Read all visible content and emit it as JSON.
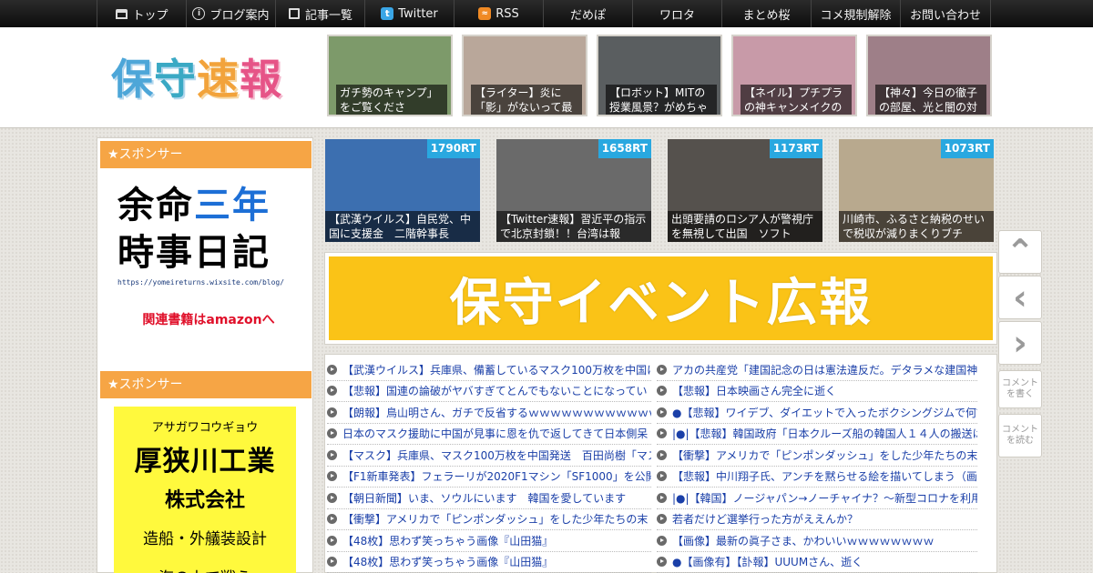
{
  "nav": {
    "items": [
      {
        "label": "トップ",
        "icon": "home-icon"
      },
      {
        "label": "ブログ案内",
        "icon": "info-icon"
      },
      {
        "label": "記事一覧",
        "icon": "list-icon"
      },
      {
        "label": "Twitter",
        "icon": "twitter-icon"
      },
      {
        "label": "RSS",
        "icon": "rss-icon"
      },
      {
        "label": "だめぽ"
      },
      {
        "label": "ワロタ"
      },
      {
        "label": "まとめ桜"
      },
      {
        "label": "コメ規制解除"
      },
      {
        "label": "お問い合わせ"
      }
    ],
    "icon_glyphs": {
      "info": "i",
      "twitter": "t",
      "rss": "≈"
    }
  },
  "header": {
    "logo": {
      "c1": "保",
      "c2": "守",
      "c3": "速",
      "c4": "報"
    },
    "thumbs": [
      {
        "caption": "ガチ勢のキャンプ」をご覧くださ",
        "color": "#7d9a6a"
      },
      {
        "caption": "【ライター】炎に「影」がないって最",
        "color": "#b9a79a"
      },
      {
        "caption": "【ロボット】MITの授業風景？がめちゃ",
        "color": "#5a5e60"
      },
      {
        "caption": "【ネイル】プチプラの神キャンメイクの",
        "color": "#c89aa8"
      },
      {
        "caption": "【神々】今日の徹子の部屋、光と闇の対",
        "color": "#9e7f88"
      }
    ]
  },
  "sidebar": {
    "title1": "★スポンサー",
    "ad1": {
      "line1a": "余命",
      "line1b": "三年",
      "line2": "時事日記",
      "url": "https://yomeireturns.wixsite.com/blog/",
      "amazon": "関連書籍はamazonへ"
    },
    "title2": "★スポンサー",
    "ad2": {
      "kana": "アサガワコウギョウ",
      "name": "厚狭川工業",
      "kk": "株式会社",
      "service": "造船・外艤装設計",
      "more": "海の上で戦う"
    }
  },
  "featured": [
    {
      "rt": "1790RT",
      "caption": "【武漢ウイルス】自民党、中国に支援金　二階幹事長",
      "color": "#3c6fb0"
    },
    {
      "rt": "1658RT",
      "caption": "【Twitter速報】習近平の指示で北京封鎖！！台湾は報",
      "color": "#6a6a6a"
    },
    {
      "rt": "1173RT",
      "caption": "出頭要請のロシア人が警視庁を無視して出国　ソフト",
      "color": "#55514d"
    },
    {
      "rt": "1073RT",
      "caption": "川崎市、ふるさと納税のせいで税収が減りまくりブチ",
      "color": "#b8a98e"
    }
  ],
  "banner": {
    "text": "保守イベント広報"
  },
  "articles": {
    "left": [
      "【武漢ウイルス】兵庫県、備蓄しているマスク100万枚を中国に",
      "【悲報】国連の論破がヤバすぎてとんでもないことになってい",
      "【朗報】鳥山明さん、ガチで反省するｗｗｗｗｗｗｗｗｗｗｗｗ",
      "日本のマスク援助に中国が見事に恩を仇で返してきて日本側呆",
      "【マスク】兵庫県、マスク100万枚を中国発送　百田尚樹「マス",
      "【F1新車発表】フェラーリが2020F1マシン「SF1000」を公開、",
      "【朝日新聞】いま、ソウルにいます　韓国を愛しています",
      "【衝撃】アメリカで「ピンポンダッシュ」をした少年たちの末",
      "【48枚】思わず笑っちゃう画像『山田猫』",
      "【48枚】思わず笑っちゃう画像『山田猫』"
    ],
    "right": [
      "アカの共産党「建国記念の日は憲法違反だ。デタラメな建国神",
      "【悲報】日本映画さん完全に逝く",
      "●【悲報】ワイデブ、ダイエットで入ったボクシングジムで何故",
      "|●|【悲報】韓国政府「日本クルーズ船の韓国人１４人の搬送は",
      "【衝撃】アメリカで「ピンポンダッシュ」をした少年たちの末",
      "【悲報】中川翔子氏、アンチを黙らせる絵を描いてしまう（画",
      "|●|【韓国】ノージャパン→ノーチャイナ？～新型コロナを利用",
      "若者だけど選挙行った方がええんか？",
      "【画像】最新の眞子さま、かわいいｗｗｗｗｗｗｗｗ",
      "●【画像有】【訃報】UUUMさん、逝く"
    ]
  },
  "controls": {
    "up": "⌃",
    "prev": "‹",
    "next": "›",
    "write": "コメントを書く",
    "read": "コメントを読む"
  }
}
